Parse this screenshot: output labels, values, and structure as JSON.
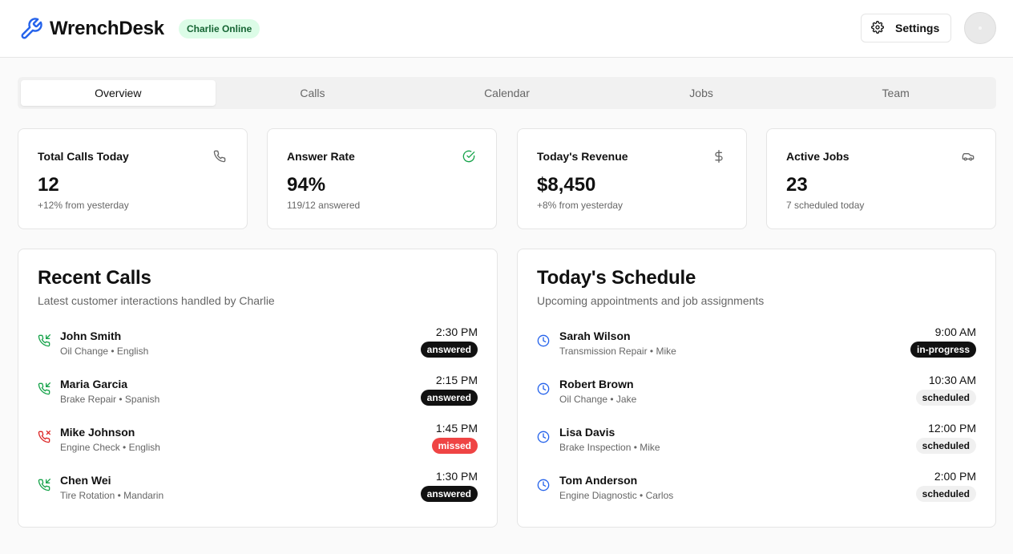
{
  "header": {
    "app_name": "WrenchDesk",
    "status_badge": "Charlie Online",
    "settings_label": "Settings"
  },
  "tabs": [
    {
      "label": "Overview",
      "active": true
    },
    {
      "label": "Calls",
      "active": false
    },
    {
      "label": "Calendar",
      "active": false
    },
    {
      "label": "Jobs",
      "active": false
    },
    {
      "label": "Team",
      "active": false
    }
  ],
  "stats": [
    {
      "title": "Total Calls Today",
      "value": "12",
      "sub": "+12% from yesterday",
      "icon": "phone-icon"
    },
    {
      "title": "Answer Rate",
      "value": "94%",
      "sub": "119/12 answered",
      "icon": "check-circle-icon"
    },
    {
      "title": "Today's Revenue",
      "value": "$8,450",
      "sub": "+8% from yesterday",
      "icon": "dollar-icon"
    },
    {
      "title": "Active Jobs",
      "value": "23",
      "sub": "7 scheduled today",
      "icon": "car-icon"
    }
  ],
  "recent_calls": {
    "title": "Recent Calls",
    "subtitle": "Latest customer interactions handled by Charlie",
    "items": [
      {
        "name": "John Smith",
        "meta": "Oil Change • English",
        "time": "2:30 PM",
        "status": "answered"
      },
      {
        "name": "Maria Garcia",
        "meta": "Brake Repair • Spanish",
        "time": "2:15 PM",
        "status": "answered"
      },
      {
        "name": "Mike Johnson",
        "meta": "Engine Check • English",
        "time": "1:45 PM",
        "status": "missed"
      },
      {
        "name": "Chen Wei",
        "meta": "Tire Rotation • Mandarin",
        "time": "1:30 PM",
        "status": "answered"
      }
    ]
  },
  "schedule": {
    "title": "Today's Schedule",
    "subtitle": "Upcoming appointments and job assignments",
    "items": [
      {
        "name": "Sarah Wilson",
        "meta": "Transmission Repair • Mike",
        "time": "9:00 AM",
        "status": "in-progress"
      },
      {
        "name": "Robert Brown",
        "meta": "Oil Change • Jake",
        "time": "10:30 AM",
        "status": "scheduled"
      },
      {
        "name": "Lisa Davis",
        "meta": "Brake Inspection • Mike",
        "time": "12:00 PM",
        "status": "scheduled"
      },
      {
        "name": "Tom Anderson",
        "meta": "Engine Diagnostic • Carlos",
        "time": "2:00 PM",
        "status": "scheduled"
      }
    ]
  },
  "colors": {
    "accent_blue": "#2563eb",
    "call_green": "#16a34a",
    "call_red": "#dc2626",
    "missed_badge": "#ef4444",
    "online_badge_bg": "#dcfce7",
    "online_badge_text": "#166534"
  }
}
